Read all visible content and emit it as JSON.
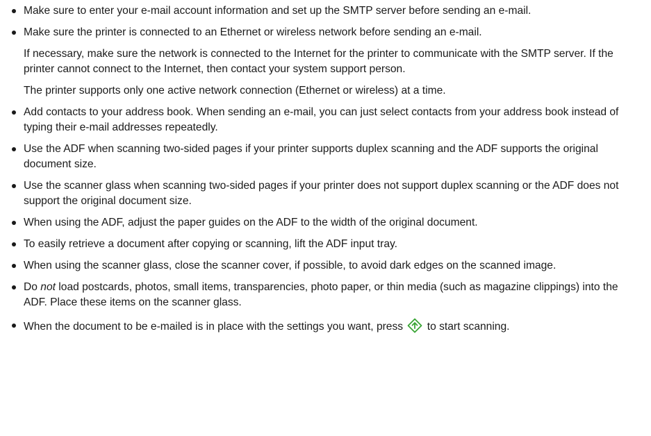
{
  "tips": {
    "email_setup": "Make sure to enter your e-mail account information and set up the SMTP server before sending an e-mail.",
    "network": "Make sure the printer is connected to an Ethernet or wireless network before sending an e-mail.",
    "internet": "If necessary, make sure the network is connected to the Internet for the printer to communicate with the SMTP server. If the printer cannot connect to the Internet, then contact your system support person.",
    "single_connection": "The printer supports only one active network connection (Ethernet or wireless) at a time.",
    "address_book": "Add contacts to your address book. When sending an e-mail, you can just select contacts from your address book instead of typing their e-mail addresses repeatedly.",
    "adf_duplex": "Use the ADF when scanning two-sided pages if your printer supports duplex scanning and the ADF supports the original document size.",
    "glass_duplex": "Use the scanner glass when scanning two-sided pages if your printer does not support duplex scanning or the ADF does not support the original document size.",
    "paper_guides": "When using the ADF, adjust the paper guides on the ADF to the width of the original document.",
    "retrieve": "To easily retrieve a document after copying or scanning, lift the ADF input tray.",
    "scanner_cover": "When using the scanner glass, close the scanner cover, if possible, to avoid dark edges on the scanned image.",
    "load_do": "Do ",
    "load_not": "not",
    "load_rest": " load postcards, photos, small items, transparencies, photo paper, or thin media (such as magazine clippings) into the ADF. Place these items on the scanner glass.",
    "start_before": "When the document to be e-mailed is in place with the settings you want, press ",
    "start_after": " to start scanning."
  },
  "icons": {
    "start": "start-diamond-icon",
    "start_color": "#3aa535"
  }
}
